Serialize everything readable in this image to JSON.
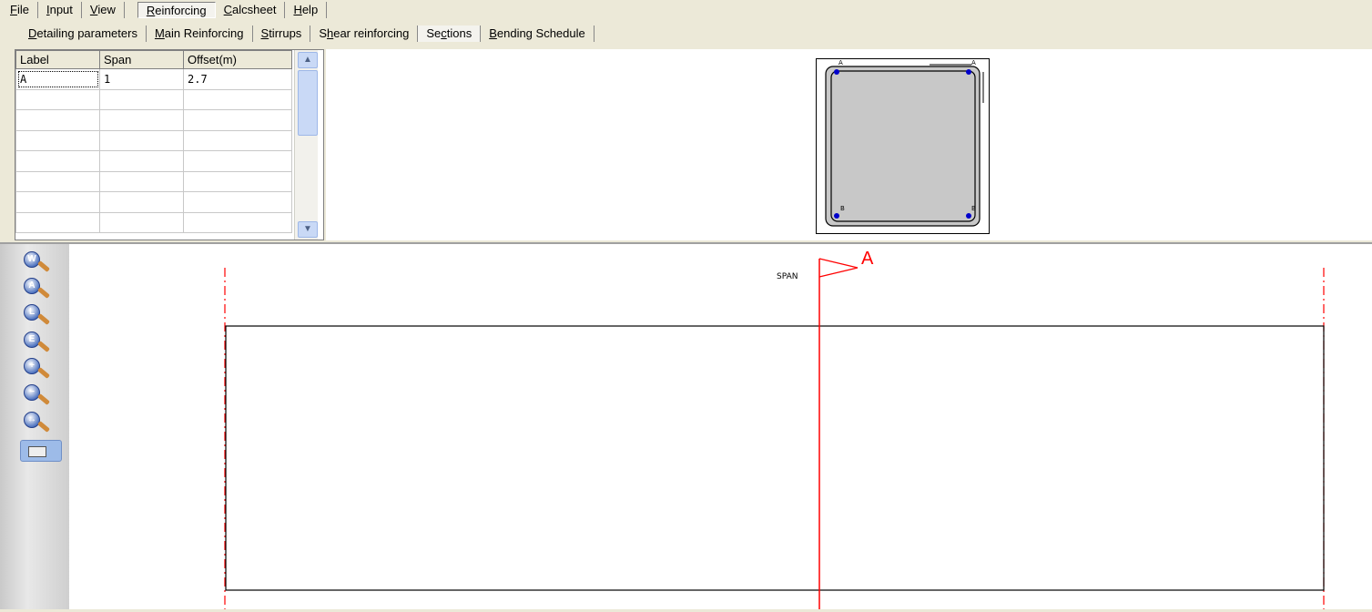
{
  "menu": {
    "items": [
      {
        "pre": "",
        "key": "F",
        "post": "ile"
      },
      {
        "pre": "",
        "key": "I",
        "post": "nput"
      },
      {
        "pre": "",
        "key": "V",
        "post": "iew"
      },
      {
        "pre": "",
        "key": "R",
        "post": "einforcing"
      },
      {
        "pre": "",
        "key": "C",
        "post": "alcsheet"
      },
      {
        "pre": "",
        "key": "H",
        "post": "elp"
      }
    ]
  },
  "tabs": {
    "items": [
      {
        "pre": "",
        "key": "D",
        "post": "etailing parameters"
      },
      {
        "pre": "",
        "key": "M",
        "post": "ain Reinforcing"
      },
      {
        "pre": "",
        "key": "S",
        "post": "tirrups"
      },
      {
        "pre": "S",
        "key": "h",
        "post": "ear reinforcing"
      },
      {
        "pre": "Se",
        "key": "c",
        "post": "tions"
      },
      {
        "pre": "",
        "key": "B",
        "post": "ending Schedule"
      }
    ]
  },
  "sections_table": {
    "headers": [
      "Label",
      "Span",
      "Offset(m)"
    ],
    "rows": [
      [
        "A",
        "1",
        "2.7"
      ]
    ]
  },
  "cross_section": {
    "top_labels": [
      "A",
      "A"
    ],
    "bottom_labels": [
      "B",
      "B"
    ]
  },
  "elevation": {
    "span_label": "SPAN",
    "section_marker": "A"
  },
  "zoom_tools": [
    "W",
    "A",
    "L",
    "E",
    "+",
    "−",
    "↔"
  ],
  "colors": {
    "section_line": "#ff0000",
    "bar_dot": "#0000cc",
    "concrete": "#c8c8c8"
  }
}
